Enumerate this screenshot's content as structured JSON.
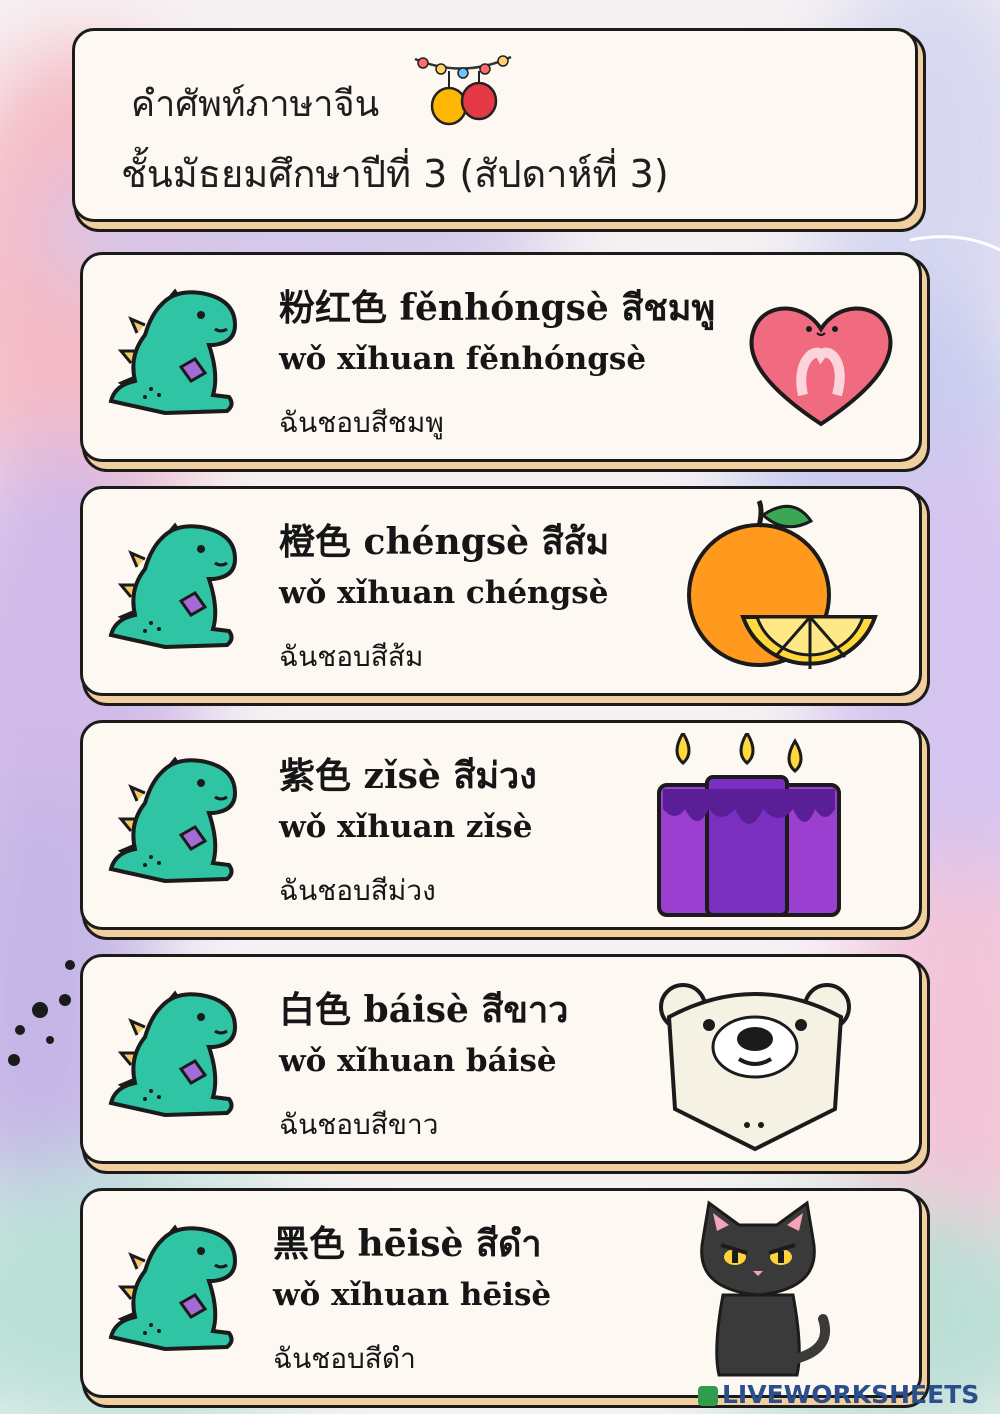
{
  "header": {
    "title_line1": "คำศัพท์ภาษาจีน",
    "title_line2": "ชั้นมัธยมศึกษาปีที่ 3 (สัปดาห์ที่ 3)",
    "decor_icon": "lantern-string-icon"
  },
  "words": [
    {
      "line1": "粉红色 fěnhóngsè สีชมพู",
      "line2": "wǒ xǐhuan fěnhóngsè",
      "line3": "ฉันชอบสีชมพู",
      "image": "pink-heart-ribbon-icon"
    },
    {
      "line1": "橙色 chéngsè สีส้ม",
      "line2": "wǒ xǐhuan chéngsè",
      "line3": "ฉันชอบสีส้ม",
      "image": "orange-fruit-icon"
    },
    {
      "line1": "紫色 zǐsè สีม่วง",
      "line2": "wǒ xǐhuan zǐsè",
      "line3": "ฉันชอบสีม่วง",
      "image": "purple-candles-icon"
    },
    {
      "line1": "白色 báisè สีขาว",
      "line2": "wǒ xǐhuan báisè",
      "line3": "ฉันชอบสีขาว",
      "image": "polar-bear-icon"
    },
    {
      "line1": "黑色 hēisè สีดำ",
      "line2": "wǒ xǐhuan hēisè",
      "line3": "ฉันชอบสีดำ",
      "image": "black-cat-icon"
    }
  ],
  "decor_icon": "dinosaur-icon",
  "footer": {
    "logo": "LIVEWORKSHEETS"
  },
  "colors": {
    "card_bg": "#fdf8f2",
    "card_shadow": "#f2cf9e",
    "dino": "#2fc4a4"
  }
}
